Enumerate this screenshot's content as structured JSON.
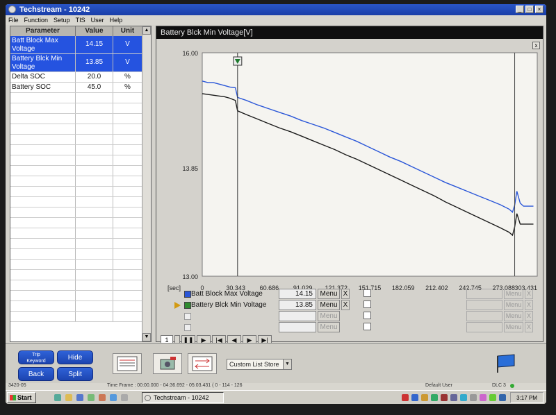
{
  "window": {
    "title": "Techstream - 10242"
  },
  "menubar": [
    "File",
    "Function",
    "Setup",
    "TIS",
    "User",
    "Help"
  ],
  "table": {
    "headers": [
      "Parameter",
      "Value",
      "Unit"
    ],
    "rows": [
      {
        "parameter": "Batt Block Max Voltage",
        "value": "14.15",
        "unit": "V",
        "selected": true
      },
      {
        "parameter": "Battery Blck Min Voltage",
        "value": "13.85",
        "unit": "V",
        "selected": true
      },
      {
        "parameter": "Delta SOC",
        "value": "20.0",
        "unit": "%",
        "selected": false
      },
      {
        "parameter": "Battery SOC",
        "value": "45.0",
        "unit": "%",
        "selected": false
      }
    ]
  },
  "graph": {
    "title": "Battery Blck Min Voltage[V]",
    "close_label": "x",
    "y_tick_labels": [
      "16.00",
      "13.85",
      "13.00"
    ],
    "x_unit_label": "[sec]",
    "x_tick_labels": [
      "0",
      "30.343",
      "60.686",
      "91.029",
      "121.372",
      "151.715",
      "182.059",
      "212.402",
      "242.745",
      "273.088",
      "303.431"
    ]
  },
  "chart_data": {
    "type": "line",
    "title": "Battery Blck Min Voltage[V]",
    "xlabel": "[sec]",
    "ylabel": "",
    "xlim": [
      0,
      303.431
    ],
    "ylim": [
      13.0,
      16.0
    ],
    "x": [
      0,
      5,
      10,
      15,
      20,
      25,
      30,
      32,
      40,
      50,
      60,
      70,
      80,
      90,
      100,
      110,
      120,
      130,
      140,
      150,
      160,
      170,
      180,
      190,
      200,
      210,
      220,
      230,
      240,
      250,
      260,
      270,
      278,
      281,
      283,
      285,
      288,
      291,
      295,
      300
    ],
    "series": [
      {
        "name": "Batt Block Max Voltage",
        "color": "#2a56d8",
        "values": [
          15.62,
          15.6,
          15.6,
          15.58,
          15.56,
          15.54,
          15.53,
          15.4,
          15.36,
          15.3,
          15.25,
          15.2,
          15.15,
          15.09,
          15.04,
          14.99,
          14.93,
          14.87,
          14.81,
          14.74,
          14.67,
          14.6,
          14.54,
          14.47,
          14.4,
          14.33,
          14.26,
          14.2,
          14.14,
          14.08,
          14.02,
          13.96,
          13.9,
          13.86,
          13.95,
          14.14,
          13.98,
          13.94,
          13.94,
          13.94
        ]
      },
      {
        "name": "Battery Blck Min Voltage",
        "color": "#1b1b1b",
        "values": [
          15.45,
          15.44,
          15.43,
          15.42,
          15.41,
          15.39,
          15.36,
          15.22,
          15.17,
          15.11,
          15.05,
          14.99,
          14.94,
          14.88,
          14.82,
          14.76,
          14.7,
          14.63,
          14.57,
          14.5,
          14.43,
          14.36,
          14.29,
          14.22,
          14.15,
          14.08,
          14.0,
          13.93,
          13.86,
          13.79,
          13.72,
          13.65,
          13.59,
          13.55,
          13.66,
          13.84,
          13.7,
          13.7,
          13.7,
          13.7
        ]
      }
    ],
    "cursor_x": 32,
    "grid": false
  },
  "legend": {
    "rows": [
      {
        "name": "Batt Block Max Voltage",
        "color": "#2a56d8",
        "value": "14.15",
        "menu": "Menu",
        "close": "X",
        "cursor": false
      },
      {
        "name": "Battery Blck Min Voltage",
        "color": "#2f8a2f",
        "value": "13.85",
        "menu": "Menu",
        "close": "X",
        "cursor": true
      },
      {
        "name": "",
        "color": "",
        "value": "",
        "menu": "Menu",
        "close": "",
        "cursor": false
      },
      {
        "name": "",
        "color": "",
        "value": "",
        "menu": "Menu",
        "close": "",
        "cursor": false
      }
    ],
    "right_menu": "Menu",
    "right_close": "X"
  },
  "playback": {
    "page_value": "1"
  },
  "buttons": {
    "trip": "Trip\nKeyword",
    "hide": "Hide",
    "back": "Back",
    "split": "Split"
  },
  "list_store": {
    "selected": "Custom List Store"
  },
  "status": {
    "left": "3420-05",
    "timeframe": "Time Frame : 00:00.000 - 04:36.692 - 05:03.431 ( 0 - 114 - 126",
    "user": "Default User",
    "dlc": "DLC 3"
  },
  "taskbar": {
    "start": "Start",
    "task_item": "Techstream - 10242",
    "clock": "3:17 PM"
  }
}
